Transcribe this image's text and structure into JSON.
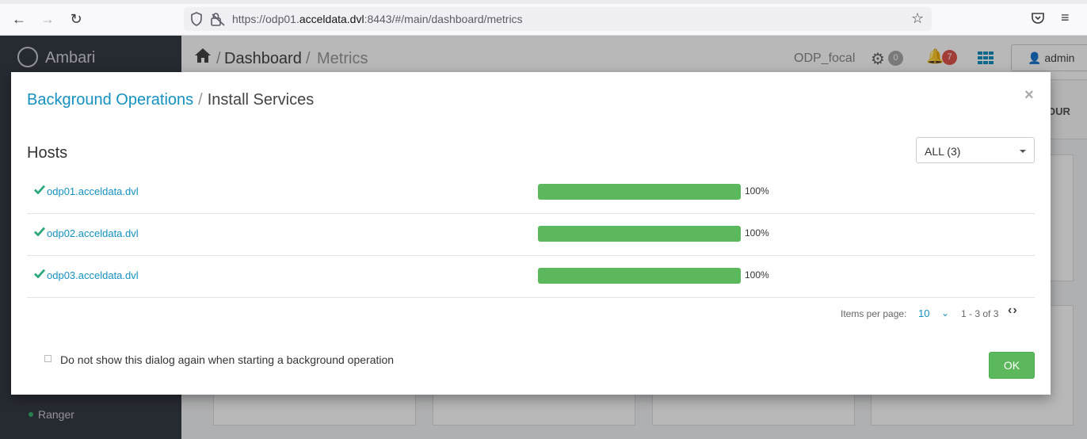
{
  "browser": {
    "url_prefix": "https://odp01.",
    "url_domain": "acceldata.dvl",
    "url_suffix": ":8443/#/main/dashboard/metrics"
  },
  "app": {
    "brand": "Ambari",
    "breadcrumb": {
      "section": "Dashboard",
      "sep": "/",
      "page": "Metrics"
    },
    "cluster_name": "ODP_focal",
    "ops_count": "0",
    "alerts_count": "7",
    "user": "admin",
    "tab_fragment": "OUR",
    "sidebar_item": "Ranger",
    "colors": {
      "sidebar": "#353c44",
      "alert_badge": "#e0544c",
      "ops_badge": "#aaaaaa",
      "accent": "#1491c1"
    }
  },
  "modal": {
    "title_link": "Background Operations",
    "title_sep": "/",
    "title_current": "Install Services",
    "close_symbol": "×",
    "hosts_heading": "Hosts",
    "filter_value": "ALL (3)",
    "hosts": [
      {
        "name": "odp01.acceldata.dvl",
        "progress": 100,
        "progress_label": "100%"
      },
      {
        "name": "odp02.acceldata.dvl",
        "progress": 100,
        "progress_label": "100%"
      },
      {
        "name": "odp03.acceldata.dvl",
        "progress": 100,
        "progress_label": "100%"
      }
    ],
    "pagination": {
      "label": "Items per page:",
      "per_page": "10",
      "range": "1 - 3 of 3"
    },
    "dont_show_label": "Do not show this dialog again when starting a background operation",
    "ok_label": "OK",
    "colors": {
      "success": "#5cb85c",
      "link": "#1491c1"
    }
  }
}
